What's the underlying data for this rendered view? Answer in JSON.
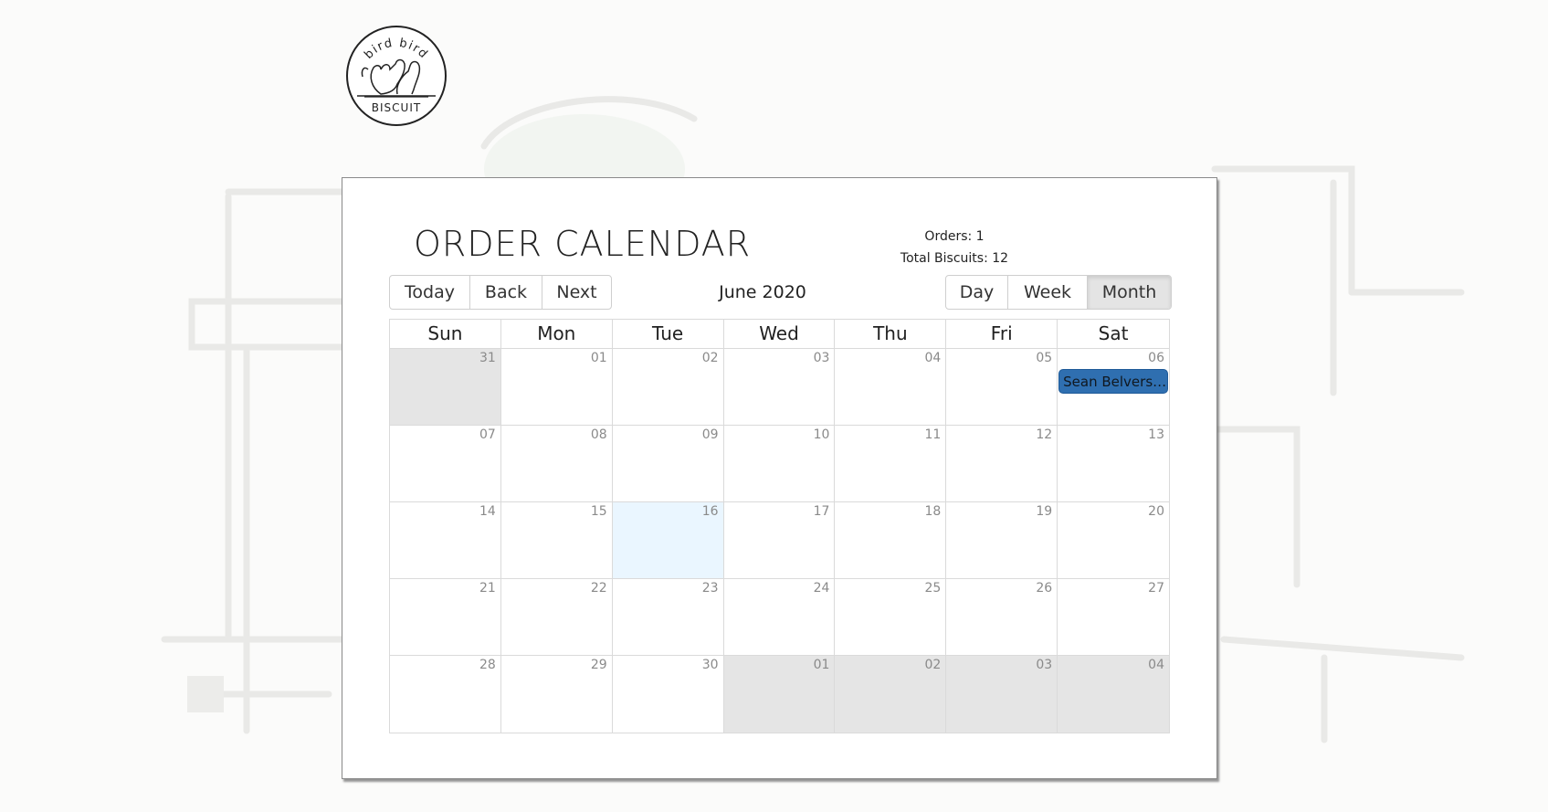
{
  "brand": {
    "logo_top_text": "bird bird",
    "logo_bottom_text": "BISCUIT"
  },
  "calendar_page": {
    "title": "ORDER CALENDAR",
    "summary": {
      "orders": "Orders: 1",
      "total_biscuits": "Total Biscuits: 12"
    },
    "nav_buttons": [
      "Today",
      "Back",
      "Next"
    ],
    "period_label": "June 2020",
    "view_buttons": [
      "Day",
      "Week",
      "Month"
    ],
    "active_view": "Month",
    "weekdays": [
      "Sun",
      "Mon",
      "Tue",
      "Wed",
      "Thu",
      "Fri",
      "Sat"
    ],
    "weeks": [
      [
        {
          "date": "31",
          "state": "off"
        },
        {
          "date": "01"
        },
        {
          "date": "02"
        },
        {
          "date": "03"
        },
        {
          "date": "04"
        },
        {
          "date": "05"
        },
        {
          "date": "06",
          "event": "Sean Belverst..."
        }
      ],
      [
        {
          "date": "07"
        },
        {
          "date": "08"
        },
        {
          "date": "09"
        },
        {
          "date": "10"
        },
        {
          "date": "11"
        },
        {
          "date": "12"
        },
        {
          "date": "13"
        }
      ],
      [
        {
          "date": "14"
        },
        {
          "date": "15"
        },
        {
          "date": "16",
          "state": "today"
        },
        {
          "date": "17"
        },
        {
          "date": "18"
        },
        {
          "date": "19"
        },
        {
          "date": "20"
        }
      ],
      [
        {
          "date": "21"
        },
        {
          "date": "22"
        },
        {
          "date": "23"
        },
        {
          "date": "24"
        },
        {
          "date": "25"
        },
        {
          "date": "26"
        },
        {
          "date": "27"
        }
      ],
      [
        {
          "date": "28"
        },
        {
          "date": "29"
        },
        {
          "date": "30"
        },
        {
          "date": "01",
          "state": "off"
        },
        {
          "date": "02",
          "state": "off"
        },
        {
          "date": "03",
          "state": "off"
        },
        {
          "date": "04",
          "state": "off"
        }
      ]
    ],
    "colors": {
      "event_bg": "#2f6fb0",
      "today_bg": "#eaf6ff",
      "off_range_bg": "#e5e5e5",
      "active_button_bg": "#e4e4e4"
    }
  }
}
